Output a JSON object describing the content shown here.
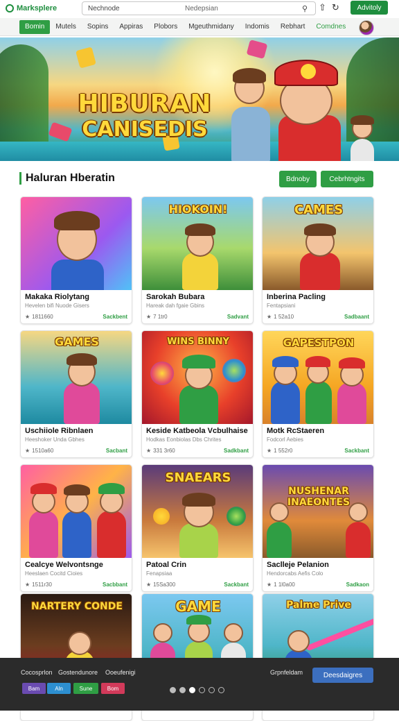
{
  "brand": {
    "name": "Marksplere"
  },
  "search": {
    "left_text": "Nechnode",
    "right_text": "Nedepsian",
    "icon": "search-icon"
  },
  "top_icons": [
    "upload-icon",
    "refresh-icon"
  ],
  "top_button": "Advitoly",
  "nav": {
    "items": [
      "Bomin",
      "Mutels",
      "Sopins",
      "Appiras",
      "Plobors",
      "Mgeuthmidany",
      "Indomis",
      "Rebhart",
      "Comdnes"
    ],
    "active_index": 0
  },
  "hero": {
    "line1": "HIBURAN",
    "line2": "CANISEDIS"
  },
  "section": {
    "title": "Haluran Hberatin",
    "buttons": [
      "Bdnoby",
      "Cebrhtngits"
    ]
  },
  "cards": [
    {
      "title": "Makaka Riolytang",
      "sub": "Hevelen bifi Nuode Gisers",
      "meta": "1811660",
      "action": "Sackbent",
      "banner": ""
    },
    {
      "title": "Sarokah Bubara",
      "sub": "Hareak dah fgaie Gbins",
      "meta": "7 1tr0",
      "action": "Sadvant",
      "banner": "HIOKOIN!"
    },
    {
      "title": "Inberina Pacling",
      "sub": "Fentapsiani",
      "meta": "1 52a10",
      "action": "Sadbaant",
      "banner": "CAMES"
    },
    {
      "title": "Uschiiole Ribnlaen",
      "sub": "Heeshoker Unda Gbhes",
      "meta": "1510a60",
      "action": "Sacbant",
      "banner": "GAMES"
    },
    {
      "title": "Keside Katbeola Vcbulhaise",
      "sub": "Hodkas Eonbiolas Dbs Chrites",
      "meta": "331 3r60",
      "action": "Sadkbant",
      "banner": "WINS BINNY"
    },
    {
      "title": "Motk RcStaeren",
      "sub": "Fodcorl Aebies",
      "meta": "1 552r0",
      "action": "Sackbant",
      "banner": "GAPESTPON"
    },
    {
      "title": "Cealcye Welvontsnge",
      "sub": "Heeslaen Cocitd Cioies",
      "meta": "1511r30",
      "action": "Sacbbant",
      "banner": ""
    },
    {
      "title": "Patoal Crin",
      "sub": "Fenapsiaa",
      "meta": "15Sa300",
      "action": "Sackbant",
      "banner": "SNAEARS"
    },
    {
      "title": "Saclleje Pelanion",
      "sub": "Hendorcabs Aefis Colo",
      "meta": "1 1l0a00",
      "action": "Sadkaon",
      "banner": "NUSHENAR INAEONTES"
    },
    {
      "title": "",
      "sub": "",
      "meta": "",
      "action": "",
      "banner": "NARTERY CONDE"
    },
    {
      "title": "",
      "sub": "",
      "meta": "",
      "action": "",
      "banner": "GAME"
    },
    {
      "title": "",
      "sub": "",
      "meta": "",
      "action": "",
      "banner": "Palme Prive"
    }
  ],
  "bottom": {
    "labels": [
      "Cocosprlon",
      "Gostendunore",
      "Ooeufenigi"
    ],
    "right_label": "Grpnfeldam",
    "button": "Deesdaigres",
    "chips": [
      {
        "label": "Bam",
        "color": "#6a4bb0"
      },
      {
        "label": "Aln",
        "color": "#2d8fd0"
      },
      {
        "label": "Sune",
        "color": "#2f9e44"
      },
      {
        "label": "Bom",
        "color": "#d23a5a"
      }
    ]
  },
  "colors": {
    "accent": "#2f9e44",
    "hero_title": "#ffd93b",
    "bottom_bg": "#2b2b2b",
    "cta_blue": "#3c6fbf"
  }
}
